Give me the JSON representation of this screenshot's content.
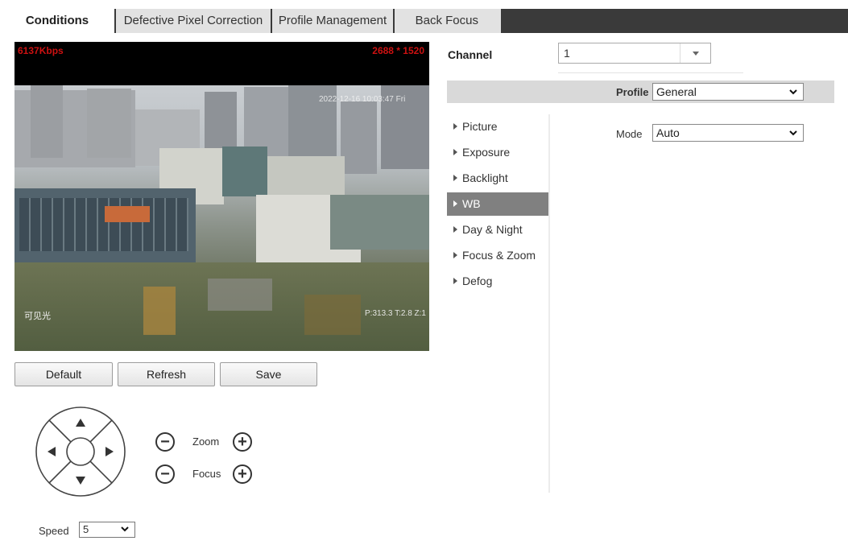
{
  "tabs": [
    {
      "label": "Conditions",
      "active": true
    },
    {
      "label": "Defective Pixel Correction",
      "active": false
    },
    {
      "label": "Profile Management",
      "active": false
    },
    {
      "label": "Back Focus",
      "active": false
    }
  ],
  "video": {
    "bitrate": "6137Kbps",
    "resolution": "2688 * 1520",
    "timestamp": "2022-12-16 10:03:47 Fri",
    "mode_text": "可见光",
    "ptz_text": "P:313.3 T:2.8 Z:1"
  },
  "actions": {
    "default_label": "Default",
    "refresh_label": "Refresh",
    "save_label": "Save"
  },
  "ptz_controls": {
    "zoom_label": "Zoom",
    "focus_label": "Focus",
    "speed_label": "Speed",
    "speed_value": "5"
  },
  "channel": {
    "label": "Channel",
    "value": "1"
  },
  "profile": {
    "label": "Profile",
    "value": "General"
  },
  "menu": {
    "items": [
      {
        "label": "Picture"
      },
      {
        "label": "Exposure"
      },
      {
        "label": "Backlight"
      },
      {
        "label": "WB"
      },
      {
        "label": "Day & Night"
      },
      {
        "label": "Focus & Zoom"
      },
      {
        "label": "Defog"
      }
    ],
    "active_item": "WB"
  },
  "wb": {
    "mode_label": "Mode",
    "mode_value": "Auto"
  },
  "colors": {
    "tab_bar": "#3a3a3a",
    "active_menu": "#808080",
    "osd_red": "#cc1111",
    "profile_bar": "#d9d9d9"
  }
}
